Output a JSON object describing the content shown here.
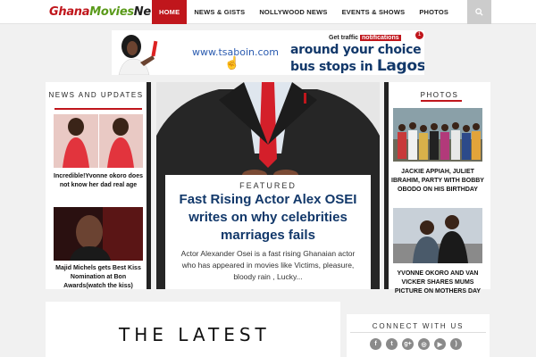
{
  "logo": {
    "part1": "Ghana",
    "part2": "Movies",
    "part3": "News"
  },
  "nav": {
    "items": [
      {
        "label": "HOME",
        "active": true
      },
      {
        "label": "NEWS & GISTS",
        "active": false
      },
      {
        "label": "NOLLYWOOD NEWS",
        "active": false
      },
      {
        "label": "EVENTS & SHOWS",
        "active": false
      },
      {
        "label": "PHOTOS",
        "active": false
      }
    ],
    "search_icon": "search-icon"
  },
  "banner": {
    "url": "www.tsaboin.com",
    "notif_prefix": "Get traffic",
    "notif_highlight": "notifications",
    "badge": "1",
    "line1": "around your choice",
    "line2_prefix": "bus stops in",
    "line2_city": "Lagos"
  },
  "left_column": {
    "title": "NEWS AND UPDATES",
    "items": [
      {
        "caption": "Incredible!Yvonne okoro does not know her dad real age"
      },
      {
        "caption": "Majid Michels gets Best Kiss Nomination at Bon Awards(watch the kiss)"
      }
    ]
  },
  "feature": {
    "label": "FEATURED",
    "title": "Fast Rising Actor Alex OSEI writes on why celebrities marriages fails",
    "excerpt": "Actor Alexander Osei is a fast rising Ghanaian actor who has appeared in movies like Victims, pleasure, bloody rain , Lucky..."
  },
  "right_column": {
    "title": "PHOTOS",
    "items": [
      {
        "caption": "JACKIE APPIAH, JULIET IBRAHIM, PARTY WITH BOBBY OBODO ON HIS BIRTHDAY"
      },
      {
        "caption": "YVONNE OKORO AND VAN VICKER SHARES MUMS PICTURE ON MOTHERS DAY"
      }
    ]
  },
  "latest": {
    "title": "THE LATEST"
  },
  "connect": {
    "title": "CONNECT WITH US",
    "icons": [
      "facebook-icon",
      "twitter-icon",
      "google-plus-icon",
      "instagram-icon",
      "youtube-icon",
      "rss-icon"
    ],
    "glyphs": [
      "f",
      "t",
      "g+",
      "◎",
      "▶",
      ")"
    ]
  },
  "colors": {
    "accent": "#c0161c",
    "title_blue": "#12386a",
    "logo_green": "#5a9a1a"
  }
}
